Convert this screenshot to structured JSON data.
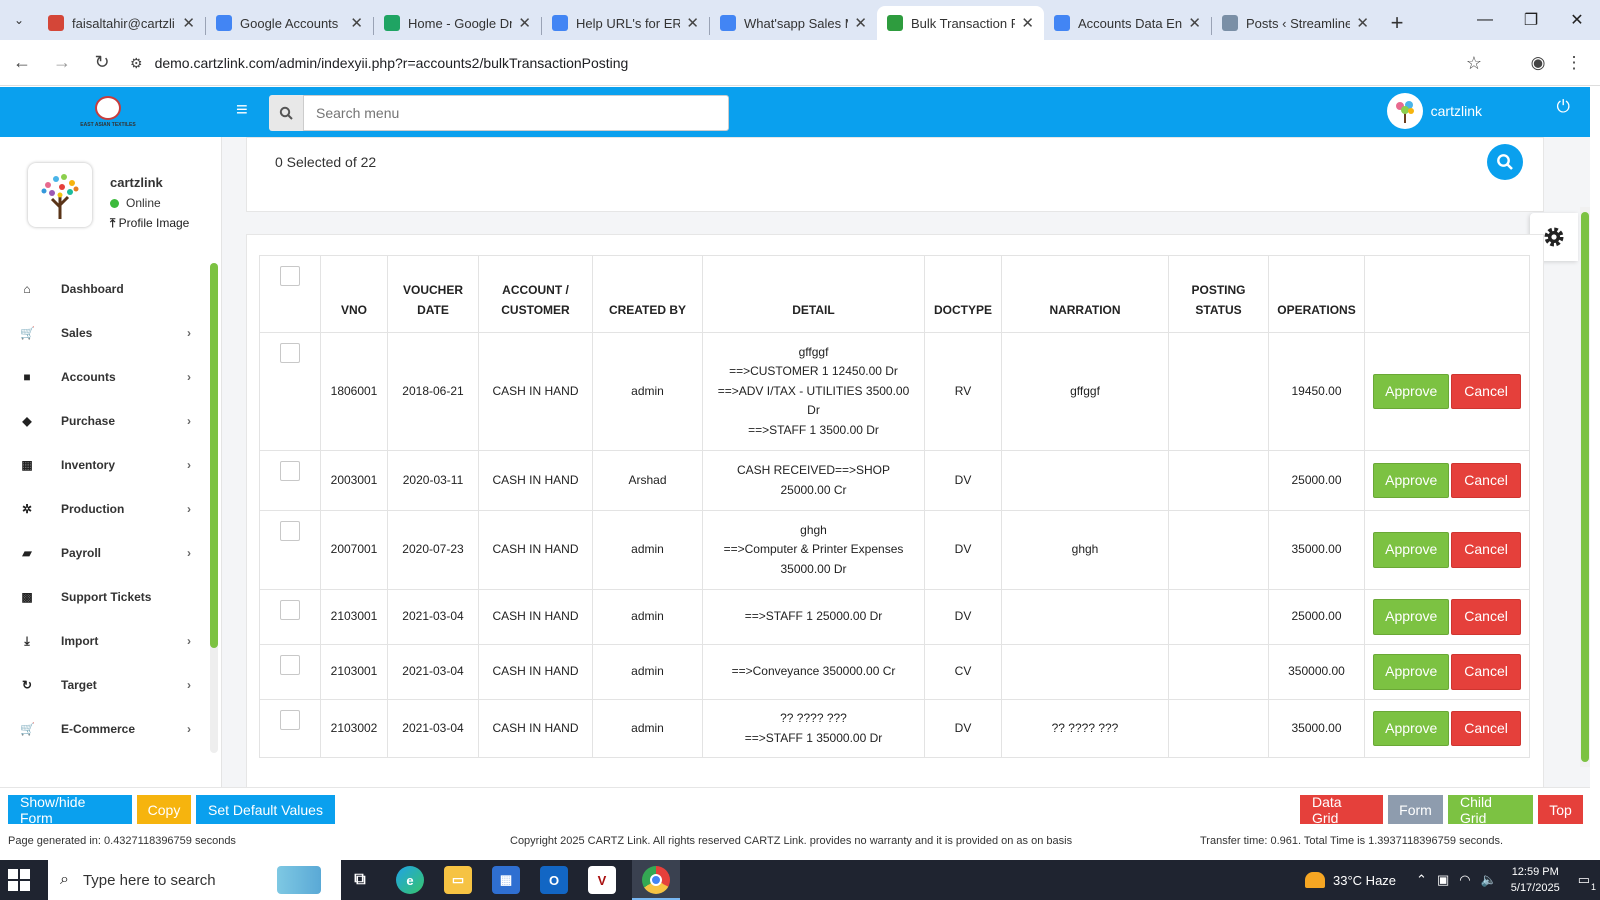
{
  "browser": {
    "tabs": [
      {
        "title": "faisaltahir@cartzli",
        "icon": "gmail-icon",
        "color": "#d44638",
        "active": false
      },
      {
        "title": "Google Accounts",
        "icon": "google-icon",
        "color": "#4285f4",
        "active": false
      },
      {
        "title": "Home - Google Dr",
        "icon": "drive-icon",
        "color": "#1fa463",
        "active": false
      },
      {
        "title": "Help URL's for ERP",
        "icon": "docs-icon",
        "color": "#4285f4",
        "active": false
      },
      {
        "title": "What'sapp Sales M",
        "icon": "docs-icon",
        "color": "#4285f4",
        "active": false
      },
      {
        "title": "Bulk Transaction P",
        "icon": "cartzlink-icon",
        "color": "#2e9c3e",
        "active": true
      },
      {
        "title": "Accounts Data Ent",
        "icon": "docs-icon",
        "color": "#4285f4",
        "active": false
      },
      {
        "title": "Posts ‹ Streamline",
        "icon": "wordpress-icon",
        "color": "#7a8fa6",
        "active": false
      }
    ],
    "url": "demo.cartzlink.com/admin/indexyii.php?r=accounts2/bulkTransactionPosting"
  },
  "header": {
    "search_placeholder": "Search menu",
    "username": "cartzlink",
    "logo_text": "EAST ASIAN TEXTILES"
  },
  "sidebar": {
    "profile_name": "cartzlink",
    "status": "Online",
    "profile_image_label": "Profile Image",
    "items": [
      {
        "label": "Dashboard",
        "icon": "home-icon",
        "glyph": "⌂",
        "has_children": false
      },
      {
        "label": "Sales",
        "icon": "cart-icon",
        "glyph": "🛒",
        "has_children": true
      },
      {
        "label": "Accounts",
        "icon": "briefcase-icon",
        "glyph": "■",
        "has_children": true
      },
      {
        "label": "Purchase",
        "icon": "tags-icon",
        "glyph": "◆",
        "has_children": true
      },
      {
        "label": "Inventory",
        "icon": "grid-icon",
        "glyph": "▦",
        "has_children": true
      },
      {
        "label": "Production",
        "icon": "cogs-icon",
        "glyph": "✲",
        "has_children": true
      },
      {
        "label": "Payroll",
        "icon": "money-icon",
        "glyph": "▰",
        "has_children": true
      },
      {
        "label": "Support Tickets",
        "icon": "ticket-icon",
        "glyph": "▩",
        "has_children": false
      },
      {
        "label": "Import",
        "icon": "download-icon",
        "glyph": "⤓",
        "has_children": true
      },
      {
        "label": "Target",
        "icon": "refresh-icon",
        "glyph": "↻",
        "has_children": true
      },
      {
        "label": "E-Commerce",
        "icon": "cart-icon",
        "glyph": "🛒",
        "has_children": true
      }
    ]
  },
  "main": {
    "selected_text": "0 Selected of 22"
  },
  "table": {
    "headers": {
      "vno": "VNO",
      "voucher_date": "VOUCHER DATE",
      "account": "ACCOUNT / CUSTOMER",
      "created_by": "CREATED BY",
      "detail": "DETAIL",
      "doctype": "DOCTYPE",
      "narration": "NARRATION",
      "posting_status": "POSTING STATUS",
      "operations": "OPERATIONS"
    },
    "approve_label": "Approve",
    "cancel_label": "Cancel",
    "rows": [
      {
        "vno": "1806001",
        "date": "2018-06-21",
        "account": "CASH IN HAND",
        "created_by": "admin",
        "detail": [
          "gffggf",
          "==>CUSTOMER 1 12450.00 Dr",
          "==>ADV I/TAX - UTILITIES 3500.00 Dr",
          "==>STAFF 1 3500.00 Dr"
        ],
        "doctype": "RV",
        "narration": "gffggf",
        "posting_status": "",
        "amount": "19450.00"
      },
      {
        "vno": "2003001",
        "date": "2020-03-11",
        "account": "CASH IN HAND",
        "created_by": "Arshad",
        "detail": [
          "CASH RECEIVED==>SHOP 25000.00 Cr"
        ],
        "doctype": "DV",
        "narration": "",
        "posting_status": "",
        "amount": "25000.00"
      },
      {
        "vno": "2007001",
        "date": "2020-07-23",
        "account": "CASH IN HAND",
        "created_by": "admin",
        "detail": [
          "ghgh",
          "==>Computer & Printer Expenses 35000.00 Dr"
        ],
        "doctype": "DV",
        "narration": "ghgh",
        "posting_status": "",
        "amount": "35000.00"
      },
      {
        "vno": "2103001",
        "date": "2021-03-04",
        "account": "CASH IN HAND",
        "created_by": "admin",
        "detail": [
          "==>STAFF 1 25000.00 Dr"
        ],
        "doctype": "DV",
        "narration": "",
        "posting_status": "",
        "amount": "25000.00"
      },
      {
        "vno": "2103001",
        "date": "2021-03-04",
        "account": "CASH IN HAND",
        "created_by": "admin",
        "detail": [
          "==>Conveyance 350000.00 Cr"
        ],
        "doctype": "CV",
        "narration": "",
        "posting_status": "",
        "amount": "350000.00"
      },
      {
        "vno": "2103002",
        "date": "2021-03-04",
        "account": "CASH IN HAND",
        "created_by": "admin",
        "detail": [
          "?? ???? ???",
          "==>STAFF 1 35000.00 Dr"
        ],
        "doctype": "DV",
        "narration": "?? ???? ???",
        "posting_status": "",
        "amount": "35000.00"
      }
    ]
  },
  "bottom_buttons": {
    "show_hide_form": "Show/hide Form",
    "copy": "Copy",
    "set_default": "Set Default Values",
    "data_grid": "Data Grid",
    "form": "Form",
    "child_grid": "Child Grid",
    "top": "Top"
  },
  "footer": {
    "page_generated": "Page generated in: 0.4327118396759 seconds",
    "copyright": "Copyright 2025 CARTZ Link. All rights reserved CARTZ Link. provides no warranty and it is provided on as on basis",
    "transfer": "Transfer time: 0.961. Total Time is 1.3937118396759 seconds."
  },
  "taskbar": {
    "search_placeholder": "Type here to search",
    "weather": "33°C  Haze",
    "time": "12:59 PM",
    "date": "5/17/2025",
    "notification_count": "1"
  },
  "colors": {
    "header_blue": "#0aa0ee",
    "approve_green": "#7cc242",
    "cancel_red": "#e5403b",
    "copy_yellow": "#f6b40e",
    "grey_button": "#8e9cae"
  }
}
